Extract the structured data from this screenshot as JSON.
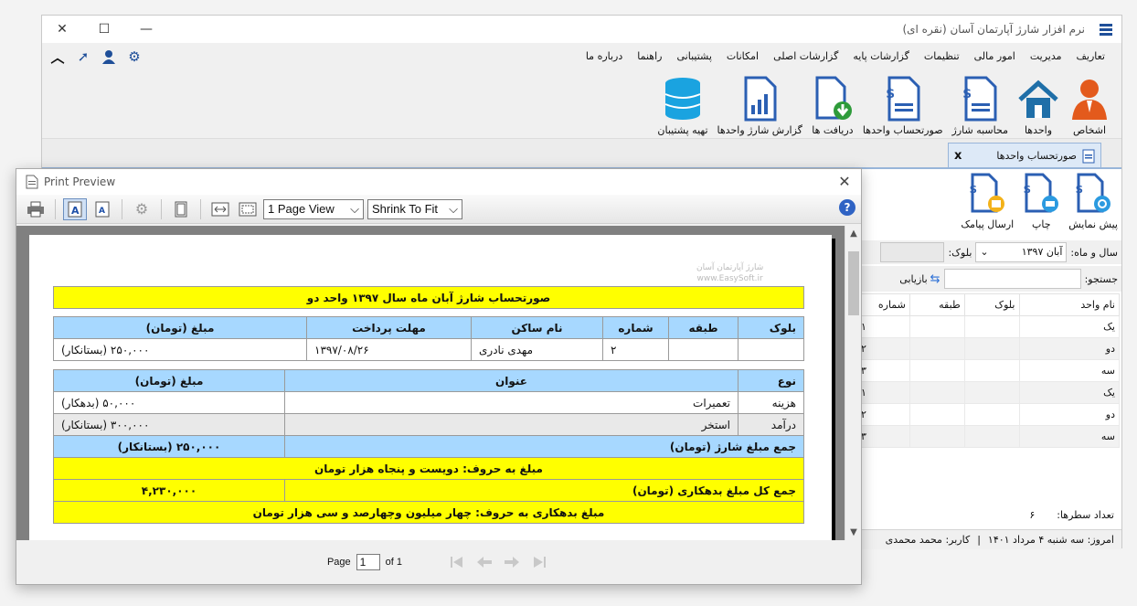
{
  "app": {
    "title": "نرم افزار شارژ آپارتمان آسان (نقره ای)",
    "menu": [
      "تعاریف",
      "مدیریت",
      "امور مالی",
      "تنظیمات",
      "گزارشات پایه",
      "گزارشات اصلی",
      "امکانات",
      "پشتیبانی",
      "راهنما",
      "درباره ما"
    ],
    "toolbar": [
      "اشخاص",
      "واحدها",
      "محاسبه شارژ",
      "صورتحساب واحدها",
      "دریافت ها",
      "گزارش شارژ واحدها",
      "تهیه پشتیبان"
    ],
    "tab_label": "صورتحساب واحدها",
    "tab_close": "x",
    "panel_buttons": [
      "پیش نمایش",
      "چاپ",
      "ارسال پیامک"
    ],
    "filter": {
      "period_label": "سال و ماه:",
      "period_value": "آبان ۱۳۹۷",
      "block_label": "بلوک:",
      "block_value": ""
    },
    "search": {
      "label": "جستجو:",
      "value": "",
      "refresh_label": "بازیابی"
    },
    "units_table": {
      "headers": [
        "نام واحد",
        "بلوک",
        "طبقه",
        "شماره"
      ],
      "rows": [
        [
          "یک",
          "",
          "",
          "۱"
        ],
        [
          "دو",
          "",
          "",
          "۲"
        ],
        [
          "سه",
          "",
          "",
          "۳"
        ],
        [
          "یک",
          "",
          "",
          "۱"
        ],
        [
          "دو",
          "",
          "",
          "۲"
        ],
        [
          "سه",
          "",
          "",
          "۳"
        ]
      ]
    },
    "row_count_label": "تعداد سطرها:",
    "row_count_value": "۶",
    "status": {
      "today": "امروز: سه شنبه ۴ مرداد ۱۴۰۱",
      "separator": "|",
      "user": "کاربر: محمد محمدی"
    }
  },
  "preview": {
    "title": "Print Preview",
    "view_mode": "1 Page View",
    "zoom_mode": "Shrink To Fit",
    "help": "?",
    "page_label": "Page",
    "page_value": "1",
    "page_of": "of 1",
    "watermark_line1": "شارژ آپارتمان آسان",
    "watermark_line2": "www.EasySoft.ir",
    "invoice": {
      "heading": "صورتحساب شارژ آبان ماه سال ۱۳۹۷ واحد دو",
      "unit_headers": [
        "بلوک",
        "طبقه",
        "شماره",
        "نام ساکن",
        "مهلت پرداخت",
        "مبلغ (تومان)"
      ],
      "unit_row": [
        "",
        "",
        "۲",
        "مهدی نادری",
        "۱۳۹۷/۰۸/۲۶",
        "۲۵۰,۰۰۰ (بستانکار)"
      ],
      "item_headers": [
        "نوع",
        "عنوان",
        "مبلغ (تومان)"
      ],
      "items": [
        [
          "هزینه",
          "تعمیرات",
          "۵۰,۰۰۰ (بدهکار)"
        ],
        [
          "درآمد",
          "استخر",
          "۳۰۰,۰۰۰ (بستانکار)"
        ]
      ],
      "total_label": "جمع مبلغ شارژ (تومان)",
      "total_value": "۲۵۰,۰۰۰ (بستانکار)",
      "total_words": "مبلغ به حروف: دویست و پنجاه هزار تومان",
      "debt_label": "جمع کل مبلغ بدهکاری (تومان)",
      "debt_value": "۴,۲۳۰,۰۰۰",
      "debt_words": "مبلغ بدهکاری به حروف: چهار میلیون وچهارصد و سی هزار تومان"
    }
  }
}
